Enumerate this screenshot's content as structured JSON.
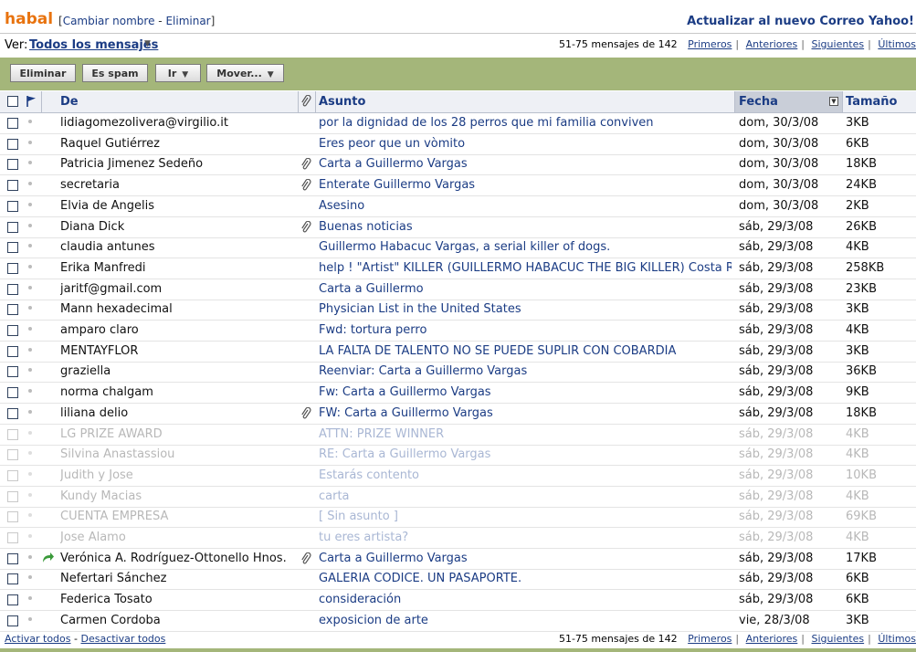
{
  "folder": {
    "name": "habal",
    "rename": "Cambiar nombre",
    "delete": "Eliminar",
    "upgrade": "Actualizar al nuevo Correo Yahoo!"
  },
  "view": {
    "label": "Ver:",
    "value": "Todos los mensajes"
  },
  "pager": {
    "count": "51-75 mensajes de 142",
    "first": "Primeros",
    "prev": "Anteriores",
    "next": "Siguientes",
    "last": "Últimos"
  },
  "toolbar": {
    "delete": "Eliminar",
    "spam": "Es spam",
    "go": "Ir",
    "move": "Mover..."
  },
  "columns": {
    "from": "De",
    "subject": "Asunto",
    "date": "Fecha",
    "size": "Tamaño"
  },
  "messages": [
    {
      "from": "lidiagomezolivera@virgilio.it",
      "subject": "por la dignidad de los 28 perros que mi familia conviven",
      "date": "dom, 30/3/08",
      "size": "3KB",
      "attach": false,
      "forwarded": false,
      "faded": false
    },
    {
      "from": "Raquel Gutiérrez",
      "subject": "Eres peor que un vòmito",
      "date": "dom, 30/3/08",
      "size": "6KB",
      "attach": false,
      "forwarded": false,
      "faded": false
    },
    {
      "from": "Patricia Jimenez Sedeño",
      "subject": "Carta a Guillermo Vargas",
      "date": "dom, 30/3/08",
      "size": "18KB",
      "attach": true,
      "forwarded": false,
      "faded": false
    },
    {
      "from": "secretaria",
      "subject": "Enterate Guillermo Vargas",
      "date": "dom, 30/3/08",
      "size": "24KB",
      "attach": true,
      "forwarded": false,
      "faded": false
    },
    {
      "from": "Elvia de Angelis",
      "subject": "Asesino",
      "date": "dom, 30/3/08",
      "size": "2KB",
      "attach": false,
      "forwarded": false,
      "faded": false
    },
    {
      "from": "Diana Dick",
      "subject": "Buenas noticias",
      "date": "sáb, 29/3/08",
      "size": "26KB",
      "attach": true,
      "forwarded": false,
      "faded": false
    },
    {
      "from": "claudia antunes",
      "subject": "Guillermo Habacuc Vargas, a serial killer of dogs.",
      "date": "sáb, 29/3/08",
      "size": "4KB",
      "attach": false,
      "forwarded": false,
      "faded": false
    },
    {
      "from": "Erika Manfredi",
      "subject": "help ! \"Artist\" KILLER (GUILLERMO HABACUC THE BIG KILLER) Costa Rica",
      "date": "sáb, 29/3/08",
      "size": "258KB",
      "attach": false,
      "forwarded": false,
      "faded": false
    },
    {
      "from": "jaritf@gmail.com",
      "subject": "Carta a Guillermo",
      "date": "sáb, 29/3/08",
      "size": "23KB",
      "attach": false,
      "forwarded": false,
      "faded": false
    },
    {
      "from": "Mann hexadecimal",
      "subject": "Physician List in the United States",
      "date": "sáb, 29/3/08",
      "size": "3KB",
      "attach": false,
      "forwarded": false,
      "faded": false
    },
    {
      "from": "amparo claro",
      "subject": "Fwd: tortura perro",
      "date": "sáb, 29/3/08",
      "size": "4KB",
      "attach": false,
      "forwarded": false,
      "faded": false
    },
    {
      "from": "MENTAYFLOR",
      "subject": "LA FALTA DE TALENTO NO SE PUEDE SUPLIR CON COBARDÍA",
      "date": "sáb, 29/3/08",
      "size": "3KB",
      "attach": false,
      "forwarded": false,
      "faded": false
    },
    {
      "from": "graziella",
      "subject": "Reenviar: Carta a Guillermo Vargas",
      "date": "sáb, 29/3/08",
      "size": "36KB",
      "attach": false,
      "forwarded": false,
      "faded": false
    },
    {
      "from": "norma chalgam",
      "subject": "Fw: Carta a Guillermo Vargas",
      "date": "sáb, 29/3/08",
      "size": "9KB",
      "attach": false,
      "forwarded": false,
      "faded": false
    },
    {
      "from": "liliana delio",
      "subject": "FW: Carta a Guillermo Vargas",
      "date": "sáb, 29/3/08",
      "size": "18KB",
      "attach": true,
      "forwarded": false,
      "faded": false
    },
    {
      "from": "LG PRIZE AWARD",
      "subject": "ATTN: PRIZE WINNER",
      "date": "sáb, 29/3/08",
      "size": "4KB",
      "attach": false,
      "forwarded": false,
      "faded": true
    },
    {
      "from": "Silvina Anastassiou",
      "subject": "RE: Carta a Guillermo Vargas",
      "date": "sáb, 29/3/08",
      "size": "4KB",
      "attach": false,
      "forwarded": false,
      "faded": true
    },
    {
      "from": "Judith y Jose",
      "subject": "Estarás contento",
      "date": "sáb, 29/3/08",
      "size": "10KB",
      "attach": false,
      "forwarded": false,
      "faded": true
    },
    {
      "from": "Kundy Macias",
      "subject": "carta",
      "date": "sáb, 29/3/08",
      "size": "4KB",
      "attach": false,
      "forwarded": false,
      "faded": true
    },
    {
      "from": "CUENTA EMPRESA",
      "subject": "[ Sin asunto ]",
      "date": "sáb, 29/3/08",
      "size": "69KB",
      "attach": false,
      "forwarded": false,
      "faded": true
    },
    {
      "from": "Jose Alamo",
      "subject": "tu eres artista?",
      "date": "sáb, 29/3/08",
      "size": "4KB",
      "attach": false,
      "forwarded": false,
      "faded": true
    },
    {
      "from": "Verónica A. Rodríguez-Ottonello Hnos.",
      "subject": "Carta a Guillermo Vargas",
      "date": "sáb, 29/3/08",
      "size": "17KB",
      "attach": true,
      "forwarded": true,
      "faded": false
    },
    {
      "from": "Nefertari Sánchez",
      "subject": "GALERIA CÓDICE. UN PASAPORTE.",
      "date": "sáb, 29/3/08",
      "size": "6KB",
      "attach": false,
      "forwarded": false,
      "faded": false
    },
    {
      "from": "Federica Tosato",
      "subject": "consideración",
      "date": "sáb, 29/3/08",
      "size": "6KB",
      "attach": false,
      "forwarded": false,
      "faded": false
    },
    {
      "from": "Carmen Cordoba",
      "subject": "exposicion de arte",
      "date": "vie, 28/3/08",
      "size": "3KB",
      "attach": false,
      "forwarded": false,
      "faded": false
    }
  ],
  "bottom": {
    "select_all": "Activar todos",
    "deselect_all": "Desactivar todos"
  }
}
